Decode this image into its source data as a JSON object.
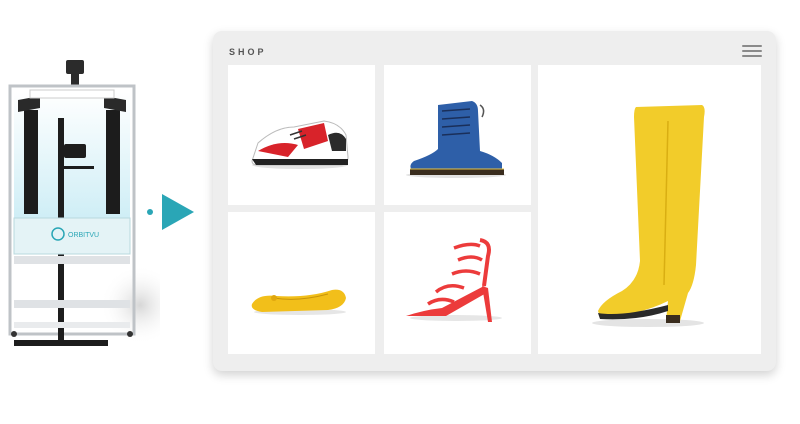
{
  "shop": {
    "title": "SHOP",
    "menu_icon": "hamburger-menu-icon",
    "products": [
      {
        "name": "sneaker",
        "color": "#d8232a"
      },
      {
        "name": "boot",
        "color": "#2e5fa8"
      },
      {
        "name": "ballet-flat",
        "color": "#f2bf1a"
      },
      {
        "name": "strappy-heel",
        "color": "#ec3b3b"
      },
      {
        "name": "knee-high-boot",
        "color": "#f2cc2a"
      }
    ]
  },
  "rig": {
    "brand": "ORBITVU",
    "arrow_icon": "play-arrow-icon",
    "accent": "#2aa6b6"
  }
}
